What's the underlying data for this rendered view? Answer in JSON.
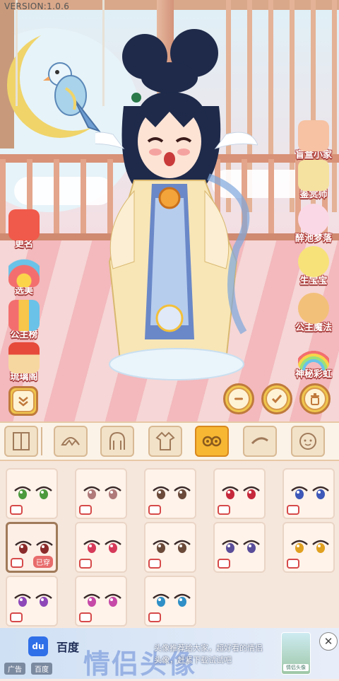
{
  "version": "VERSION:1.0.6",
  "left_menu": [
    {
      "label": "更名",
      "icon": "gift-icon"
    },
    {
      "label": "选美",
      "icon": "fan-icon"
    },
    {
      "label": "公主榜",
      "icon": "trophy-icon"
    },
    {
      "label": "琉璃阁",
      "icon": "shop-icon"
    }
  ],
  "right_menu": [
    {
      "label": "盲盒小家",
      "icon": "blind-box-icon"
    },
    {
      "label": "鉴赏师",
      "icon": "cat-icon"
    },
    {
      "label": "醉池梦落",
      "icon": "fox-icon"
    },
    {
      "label": "生宝宝",
      "icon": "baby-icon"
    },
    {
      "label": "公主魔法",
      "icon": "prince-icon"
    },
    {
      "label": "神秘彩虹",
      "icon": "rainbow-icon"
    }
  ],
  "actions": [
    "minus-icon",
    "check-icon",
    "trash-icon"
  ],
  "tabs": [
    {
      "name": "tab-wardrobe",
      "icon": "door-icon"
    },
    {
      "name": "tab-bangs",
      "icon": "bangs-icon"
    },
    {
      "name": "tab-hair",
      "icon": "hair-icon"
    },
    {
      "name": "tab-clothes",
      "icon": "robe-icon"
    },
    {
      "name": "tab-eyes",
      "icon": "eyes-icon",
      "active": true
    },
    {
      "name": "tab-brows",
      "icon": "brow-icon"
    },
    {
      "name": "tab-face",
      "icon": "face-icon"
    }
  ],
  "grid": {
    "worn_label": "已穿",
    "items": [
      {
        "eye_color": "#4c9a3d"
      },
      {
        "eye_color": "#b07a7a"
      },
      {
        "eye_color": "#6b4a3a"
      },
      {
        "eye_color": "#c6283b"
      },
      {
        "eye_color": "#3d58b8"
      },
      {
        "eye_color": "#8b2a2a",
        "worn": true
      },
      {
        "eye_color": "#d63a5a"
      },
      {
        "eye_color": "#6b4a3a"
      },
      {
        "eye_color": "#5a4d9a"
      },
      {
        "eye_color": "#e0a020"
      },
      {
        "eye_color": "#8e48b8"
      },
      {
        "eye_color": "#c64aa8"
      },
      {
        "eye_color": "#2f8fc6"
      }
    ]
  },
  "ad": {
    "brand": "百度",
    "big_text": "情侣头像",
    "copy": "头像推荐给大家，超好看的情侣头像，赶紧下载试试吧",
    "tag1": "广告",
    "tag2": "百度",
    "thumb_text": "情侣头像",
    "close": "✕",
    "logo": "du"
  },
  "colors": {
    "accent": "#f7b733",
    "label_outline": "#b3413f",
    "card_border": "#ead5c6"
  }
}
